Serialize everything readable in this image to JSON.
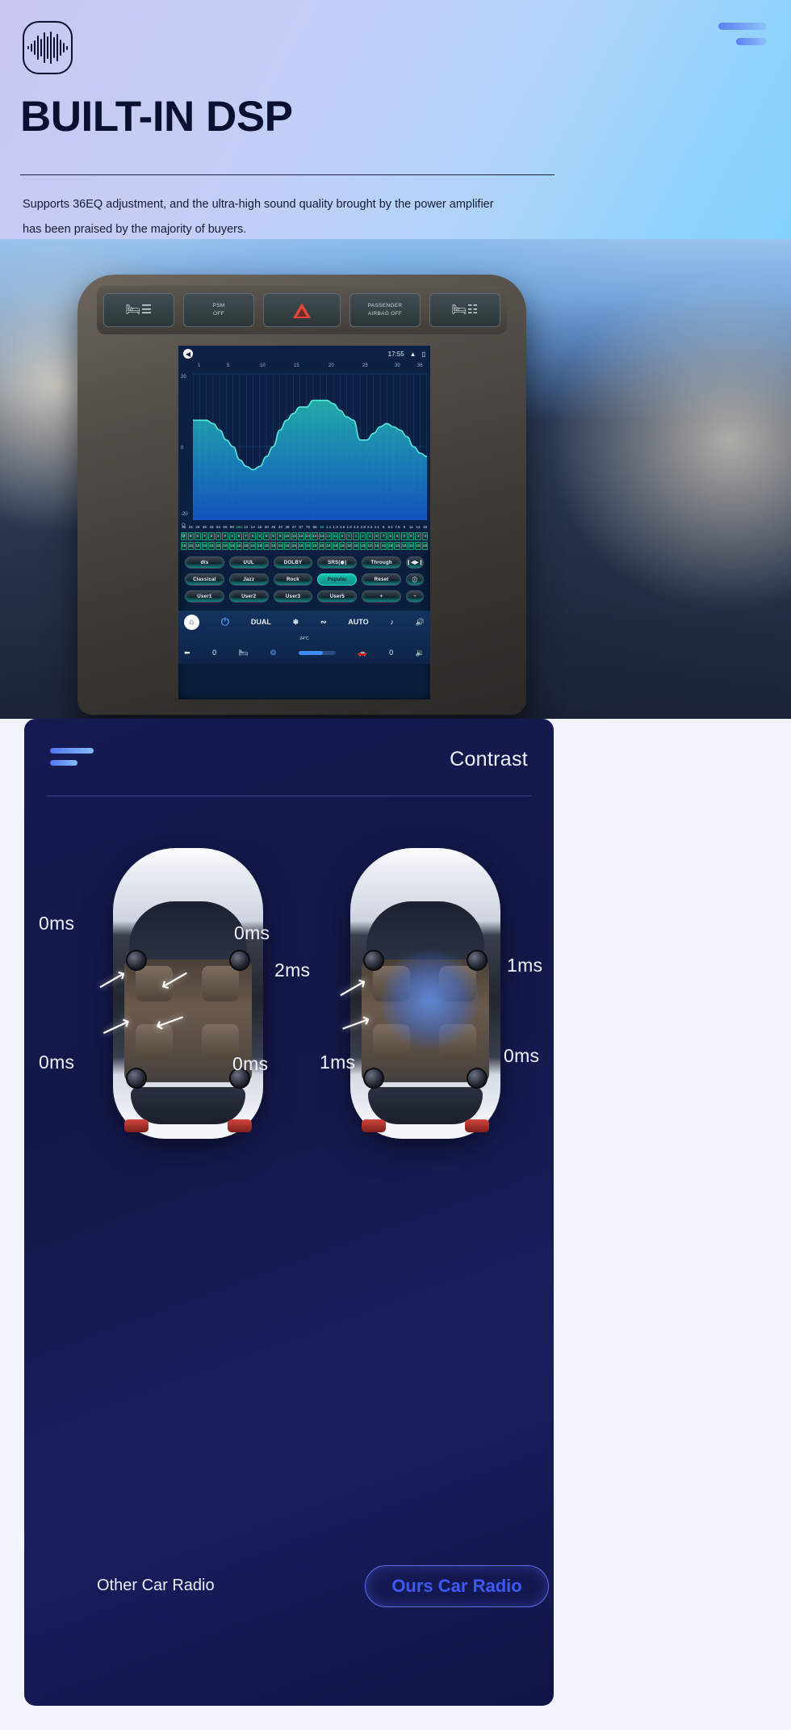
{
  "hero": {
    "logo_icon": "audio-waveform-icon",
    "menu_icon": "hamburger-menu-icon",
    "title": "BUILT-IN DSP",
    "description": "Supports 36EQ adjustment, and the ultra-high sound quality brought by the power amplifier has been praised by the majority of buyers."
  },
  "dashboard": {
    "buttons": [
      {
        "label": "seat-heater",
        "icon": "seat-heater-icon"
      },
      {
        "label": "PSM\nOFF",
        "icon": "psm-off-icon"
      },
      {
        "label": "hazard",
        "icon": "hazard-triangle-icon"
      },
      {
        "label": "PASSENGER\nAIRBAG OFF",
        "icon": "airbag-off-icon"
      },
      {
        "label": "seat-vent",
        "icon": "seat-vent-icon"
      }
    ]
  },
  "screen": {
    "status": {
      "time": "17:55",
      "volume_icon": "speaker-icon",
      "up_icon": "chevron-up-icon",
      "battery_icon": "battery-icon"
    },
    "eq": {
      "x_ticks": [
        "1",
        "5",
        "10",
        "15",
        "20",
        "25",
        "30",
        "36"
      ],
      "y_top": "20",
      "y_mid": "0",
      "y_bottom": "-20",
      "q_label": "Q",
      "curve": [
        8,
        8,
        8,
        7,
        5,
        2,
        0,
        -4,
        -6,
        -7,
        -6,
        -3,
        0,
        5,
        8,
        10,
        12,
        12,
        14,
        14,
        14,
        13,
        11,
        9,
        8,
        2,
        2,
        4,
        6,
        7,
        6,
        5,
        3,
        0,
        -2,
        -3
      ],
      "freq_labels": [
        "20",
        "24",
        "29",
        "36",
        "43",
        "54",
        "65",
        "80",
        "100",
        "12",
        "14",
        "18",
        "20",
        "26",
        "32",
        "39",
        "47",
        "57",
        "70",
        "85",
        "18",
        "1.1",
        "1.3",
        "1.6",
        "1.9",
        "2.2",
        "2.8",
        "2.4",
        "4.1",
        "5",
        "6.1",
        "7.5",
        "9",
        "11",
        "14",
        "18"
      ],
      "gain_row": [
        "8",
        "8",
        "8",
        "7",
        "5",
        "2",
        "0",
        "4",
        "0",
        "7",
        "6",
        "3",
        "0",
        "5",
        "8",
        "10",
        "12",
        "12",
        "14",
        "14",
        "14",
        "13",
        "11",
        "9",
        "8",
        "2",
        "2",
        "4",
        "6",
        "7",
        "6",
        "5",
        "3",
        "0",
        "-2",
        "-3"
      ],
      "q_row": [
        "16",
        "16",
        "16",
        "16",
        "16",
        "16",
        "16",
        "16",
        "16",
        "16",
        "16",
        "16",
        "16",
        "16",
        "16",
        "16",
        "16",
        "16",
        "16",
        "16",
        "16",
        "16",
        "16",
        "16",
        "16",
        "16",
        "16",
        "16",
        "16",
        "16",
        "16",
        "16",
        "16",
        "16",
        "16",
        "16"
      ]
    },
    "presets": {
      "row1": [
        "dts",
        "UUL",
        "DOLBY",
        "SRS(◉)",
        "Through",
        "❙◀▶❙"
      ],
      "row2": [
        "Classical",
        "Jazz",
        "Rock",
        "Popular",
        "Reset",
        "ⓘ"
      ],
      "row3": [
        "User1",
        "User2",
        "User3",
        "User5",
        "+",
        "−"
      ],
      "active": "Popular"
    },
    "climate": {
      "home_icon": "home-icon",
      "power_icon": "power-icon",
      "dual_label": "DUAL",
      "snow_icon": "snowflake-icon",
      "defrost_icon": "rear-defrost-icon",
      "temperature": "24°C",
      "auto_label": "AUTO",
      "seat_heat_icon": "seat-heat-icon",
      "volume_icon": "volume-up-icon",
      "back_icon": "back-arrow-icon",
      "left_value": "0",
      "seat_icon": "seat-icon",
      "fan_icon": "fan-icon",
      "recirc_icon": "recirculation-icon",
      "right_value": "0",
      "volume_down_icon": "volume-down-icon"
    }
  },
  "contrast": {
    "menu_icon": "hamburger-menu-icon",
    "title": "Contrast",
    "left_car": {
      "caption": "Other Car Radio",
      "delays": {
        "front_left": "0ms",
        "front_right": "0ms",
        "rear_left": "0ms",
        "rear_right": "0ms"
      }
    },
    "right_car": {
      "caption": "Ours Car Radio",
      "delays": {
        "front_left": "2ms",
        "front_right": "1ms",
        "rear_left": "1ms",
        "rear_right": "0ms"
      }
    },
    "accent_color": "#3f58f2"
  }
}
